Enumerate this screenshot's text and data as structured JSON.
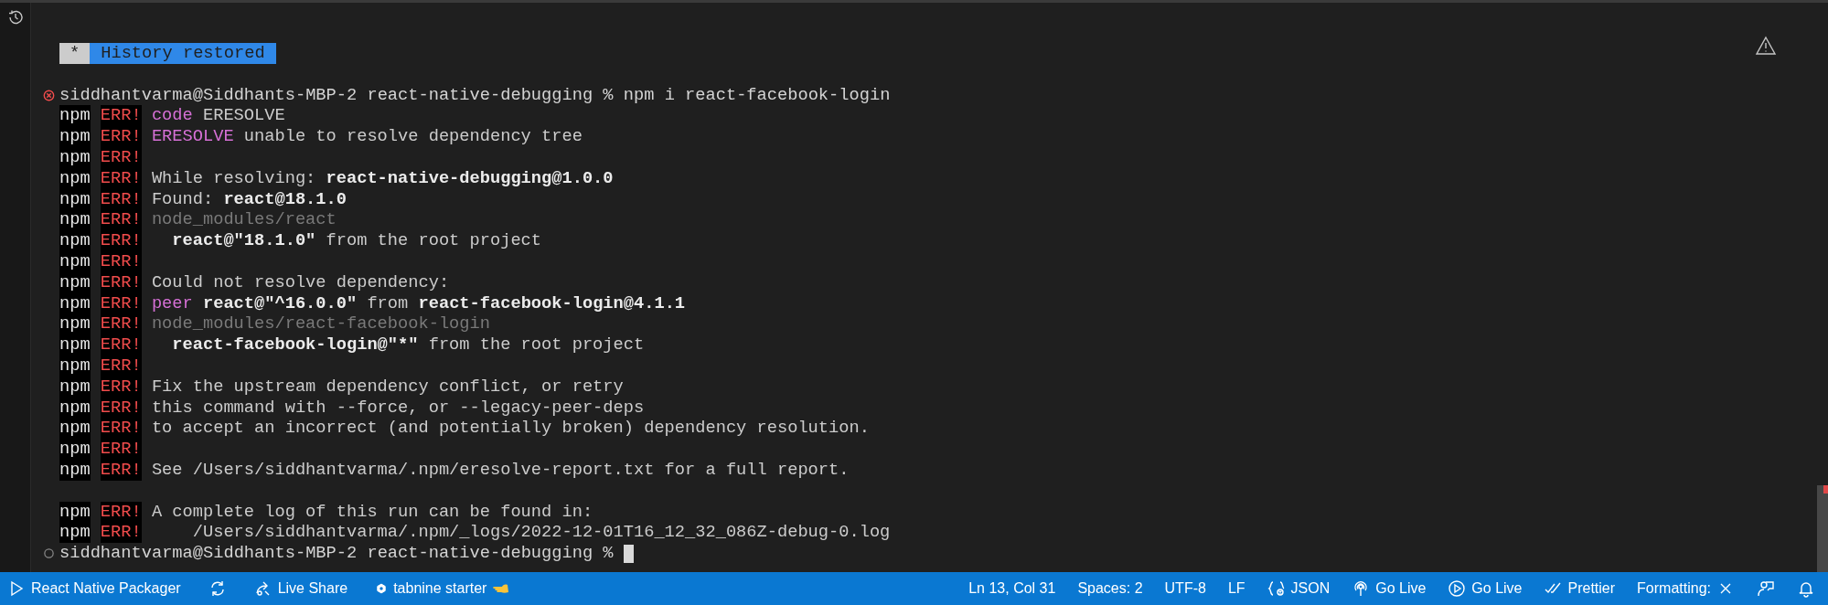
{
  "terminal": {
    "banner": {
      "mark": "*",
      "text": "History restored"
    },
    "lines": [
      {
        "kind": "prompt",
        "failed": true,
        "user": "siddhantvarma@Siddhants-MBP-2 react-native-debugging % ",
        "command": "npm i react-facebook-login",
        "cursor": false
      },
      {
        "kind": "log",
        "prefix": "npm",
        "level": "ERR!",
        "parts": [
          {
            "kind": "keyword",
            "text": "code"
          },
          {
            "kind": "plain",
            "text": " ERESOLVE"
          }
        ]
      },
      {
        "kind": "log",
        "prefix": "npm",
        "level": "ERR!",
        "parts": [
          {
            "kind": "keyword",
            "text": "ERESOLVE"
          },
          {
            "kind": "plain",
            "text": " unable to resolve dependency tree"
          }
        ]
      },
      {
        "kind": "log",
        "prefix": "npm",
        "level": "ERR!"
      },
      {
        "kind": "log",
        "prefix": "npm",
        "level": "ERR!",
        "parts": [
          {
            "kind": "plain",
            "text": "While resolving: "
          },
          {
            "kind": "bold",
            "text": "react-native-debugging@1.0.0"
          }
        ]
      },
      {
        "kind": "log",
        "prefix": "npm",
        "level": "ERR!",
        "parts": [
          {
            "kind": "plain",
            "text": "Found: "
          },
          {
            "kind": "bold",
            "text": "react@18.1.0"
          }
        ]
      },
      {
        "kind": "log",
        "prefix": "npm",
        "level": "ERR!",
        "parts": [
          {
            "kind": "dim",
            "text": "node_modules/react"
          }
        ]
      },
      {
        "kind": "log",
        "prefix": "npm",
        "level": "ERR!",
        "parts": [
          {
            "kind": "bold",
            "text": "  react@\"18.1.0\""
          },
          {
            "kind": "plain",
            "text": " from the root project"
          }
        ]
      },
      {
        "kind": "log",
        "prefix": "npm",
        "level": "ERR!"
      },
      {
        "kind": "log",
        "prefix": "npm",
        "level": "ERR!",
        "parts": [
          {
            "kind": "plain",
            "text": "Could not resolve dependency:"
          }
        ]
      },
      {
        "kind": "log",
        "prefix": "npm",
        "level": "ERR!",
        "parts": [
          {
            "kind": "keyword",
            "text": "peer"
          },
          {
            "kind": "bold",
            "text": " react@\"^16.0.0\""
          },
          {
            "kind": "plain",
            "text": " from "
          },
          {
            "kind": "bold",
            "text": "react-facebook-login@4.1.1"
          }
        ]
      },
      {
        "kind": "log",
        "prefix": "npm",
        "level": "ERR!",
        "parts": [
          {
            "kind": "dim",
            "text": "node_modules/react-facebook-login"
          }
        ]
      },
      {
        "kind": "log",
        "prefix": "npm",
        "level": "ERR!",
        "parts": [
          {
            "kind": "bold",
            "text": "  react-facebook-login@\"*\""
          },
          {
            "kind": "plain",
            "text": " from the root project"
          }
        ]
      },
      {
        "kind": "log",
        "prefix": "npm",
        "level": "ERR!"
      },
      {
        "kind": "log",
        "prefix": "npm",
        "level": "ERR!",
        "parts": [
          {
            "kind": "plain",
            "text": "Fix the upstream dependency conflict, or retry"
          }
        ]
      },
      {
        "kind": "log",
        "prefix": "npm",
        "level": "ERR!",
        "parts": [
          {
            "kind": "plain",
            "text": "this command with --force, or --legacy-peer-deps"
          }
        ]
      },
      {
        "kind": "log",
        "prefix": "npm",
        "level": "ERR!",
        "parts": [
          {
            "kind": "plain",
            "text": "to accept an incorrect (and potentially broken) dependency resolution."
          }
        ]
      },
      {
        "kind": "log",
        "prefix": "npm",
        "level": "ERR!"
      },
      {
        "kind": "log",
        "prefix": "npm",
        "level": "ERR!",
        "parts": [
          {
            "kind": "plain",
            "text": "See /Users/siddhantvarma/.npm/eresolve-report.txt for a full report."
          }
        ]
      },
      {
        "kind": "blank"
      },
      {
        "kind": "log",
        "prefix": "npm",
        "level": "ERR!",
        "parts": [
          {
            "kind": "plain",
            "text": "A complete log of this run can be found in:"
          }
        ]
      },
      {
        "kind": "log",
        "prefix": "npm",
        "level": "ERR!",
        "parts": [
          {
            "kind": "plain",
            "text": "    /Users/siddhantvarma/.npm/_logs/2022-12-01T16_12_32_086Z-debug-0.log"
          }
        ]
      },
      {
        "kind": "prompt",
        "failed": false,
        "user": "siddhantvarma@Siddhants-MBP-2 react-native-debugging % ",
        "cursor": true
      }
    ]
  },
  "status_bar": {
    "left": [
      {
        "kind": "packager",
        "text": "React Native Packager"
      },
      {
        "kind": "sync"
      },
      {
        "kind": "share",
        "text": "Live Share"
      },
      {
        "kind": "tabnine",
        "text": "tabnine starter"
      }
    ],
    "right": [
      {
        "kind": "plain",
        "text": "Ln 13, Col 31"
      },
      {
        "kind": "plain",
        "text": "Spaces: 2"
      },
      {
        "kind": "plain",
        "text": "UTF-8"
      },
      {
        "kind": "plain",
        "text": "LF"
      },
      {
        "kind": "language",
        "text": "JSON"
      },
      {
        "kind": "broadcast",
        "text": "Go Live"
      },
      {
        "kind": "preview",
        "text": "Go Live"
      },
      {
        "kind": "prettier",
        "text": "Prettier"
      },
      {
        "kind": "formatting",
        "text": "Formatting:"
      },
      {
        "kind": "feedback"
      },
      {
        "kind": "notifications"
      }
    ]
  }
}
